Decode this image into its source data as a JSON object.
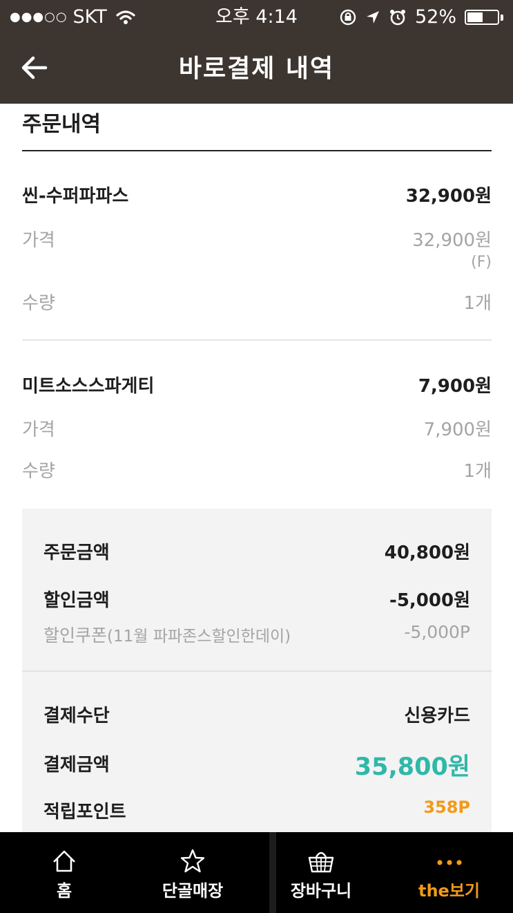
{
  "status_bar": {
    "carrier": "SKT",
    "time": "오후 4:14",
    "battery": "52%",
    "battery_level": 0.52
  },
  "header": {
    "title": "바로결제 내역"
  },
  "order": {
    "section_title": "주문내역",
    "items": [
      {
        "name": "씬-수퍼파파스",
        "total": "32,900원",
        "price_label": "가격",
        "price": "32,900원",
        "price_note": "(F)",
        "qty_label": "수량",
        "qty": "1개"
      },
      {
        "name": "미트소스스파게티",
        "total": "7,900원",
        "price_label": "가격",
        "price": "7,900원",
        "qty_label": "수량",
        "qty": "1개"
      }
    ]
  },
  "summary": {
    "order_amount_label": "주문금액",
    "order_amount": "40,800원",
    "discount_label": "할인금액",
    "discount": "-5,000원",
    "coupon_label": "할인쿠폰",
    "coupon_detail": "(11월 파파존스할인한데이)",
    "coupon_value": "-5,000P",
    "payment_method_label": "결제수단",
    "payment_method": "신용카드",
    "payment_amount_label": "결제금액",
    "payment_amount": "35,800원",
    "points_label": "적립포인트",
    "points": "358P"
  },
  "tabbar": {
    "tabs": [
      {
        "label": "홈",
        "icon": "home-icon"
      },
      {
        "label": "단골매장",
        "icon": "star-icon"
      },
      {
        "label": "장바구니",
        "icon": "basket-icon"
      },
      {
        "label": "the보기",
        "icon": "more-dots-icon"
      }
    ]
  },
  "colors": {
    "header_bg": "#3d3630",
    "tab_bg": "#000000",
    "accent_teal": "#2fb8a8",
    "accent_orange": "#f29a1a",
    "text_gray": "#a4a4a4",
    "summary_bg": "#f3f3f3"
  }
}
